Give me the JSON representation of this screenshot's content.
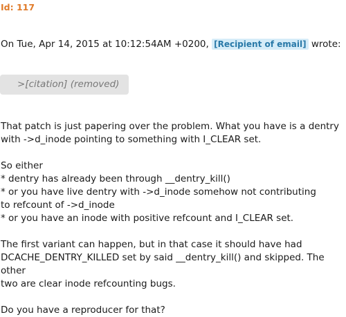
{
  "id_label": "Id: 117",
  "header": {
    "prefix": "On Tue, Apr 14, 2015 at 10:12:54AM +0200,",
    "recipient": "[Recipient of email]",
    "suffix": "wrote:"
  },
  "citation": ">[citation] (removed)",
  "paragraphs": [
    "That patch is just papering over the problem. What you have is a dentry\nwith ->d_inode pointing to something with I_CLEAR set.",
    "So either\n* dentry has already been through __dentry_kill()\n* or you have live dentry with ->d_inode somehow not contributing\nto refcount of ->d_inode\n* or you have an inode with positive refcount and I_CLEAR set.",
    "The first variant can happen, but in that case it should have had\nDCACHE_DENTRY_KILLED set by said __dentry_kill() and skipped. The other\ntwo are clear inode refcounting bugs.",
    "Do you have a reproducer for that?"
  ]
}
